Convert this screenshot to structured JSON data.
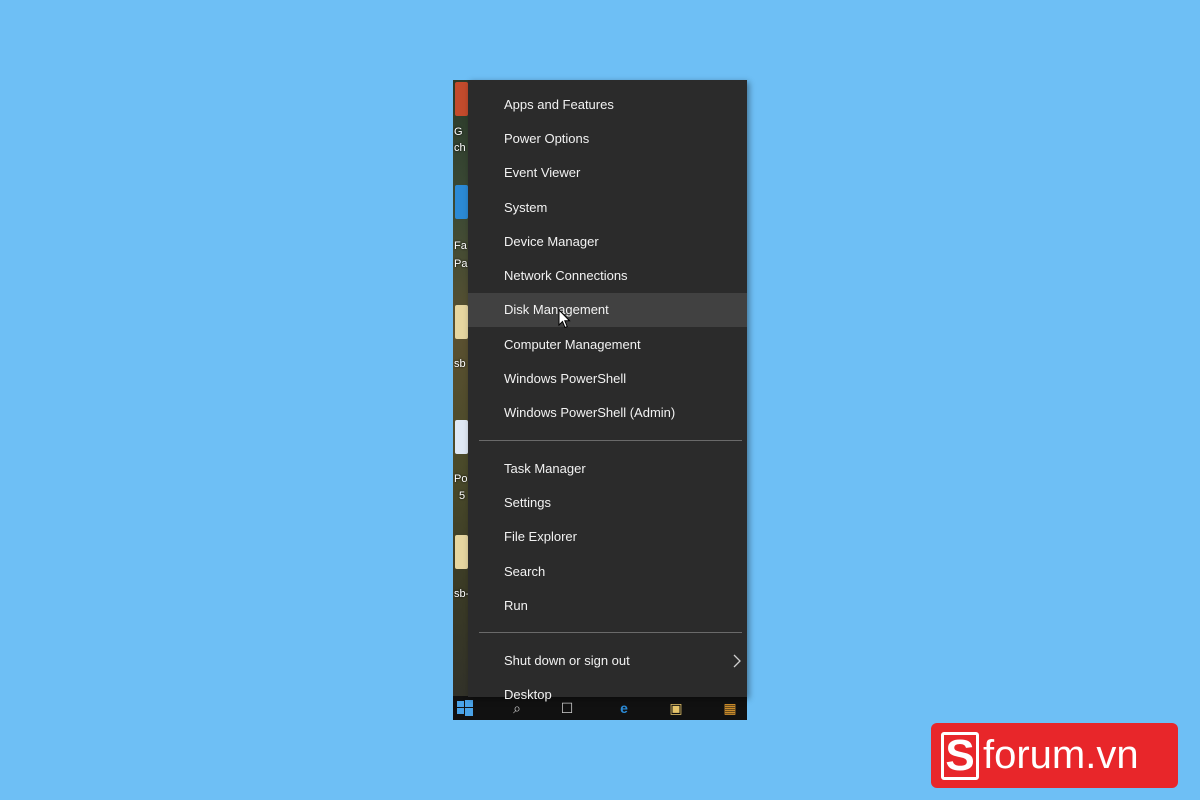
{
  "menu": {
    "group1": [
      {
        "label": "Apps and Features"
      },
      {
        "label": "Power Options"
      },
      {
        "label": "Event Viewer"
      },
      {
        "label": "System"
      },
      {
        "label": "Device Manager"
      },
      {
        "label": "Network Connections"
      },
      {
        "label": "Disk Management"
      },
      {
        "label": "Computer Management"
      },
      {
        "label": "Windows PowerShell"
      },
      {
        "label": "Windows PowerShell (Admin)"
      }
    ],
    "group2": [
      {
        "label": "Task Manager"
      },
      {
        "label": "Settings"
      },
      {
        "label": "File Explorer"
      },
      {
        "label": "Search"
      },
      {
        "label": "Run"
      }
    ],
    "group3": [
      {
        "label": "Shut down or sign out"
      },
      {
        "label": "Desktop"
      }
    ],
    "hovered_item": "Disk Management"
  },
  "desktop_labels": [
    "G",
    "ch",
    "Fa",
    "Par",
    "sb",
    "Po",
    "5",
    "sb-"
  ],
  "logo": {
    "mark": "S",
    "text": "forum.vn"
  },
  "colors": {
    "background": "#6ebff5",
    "menu_bg": "#2b2b2b",
    "hover_bg": "#414141",
    "logo_red": "#e8262a"
  }
}
